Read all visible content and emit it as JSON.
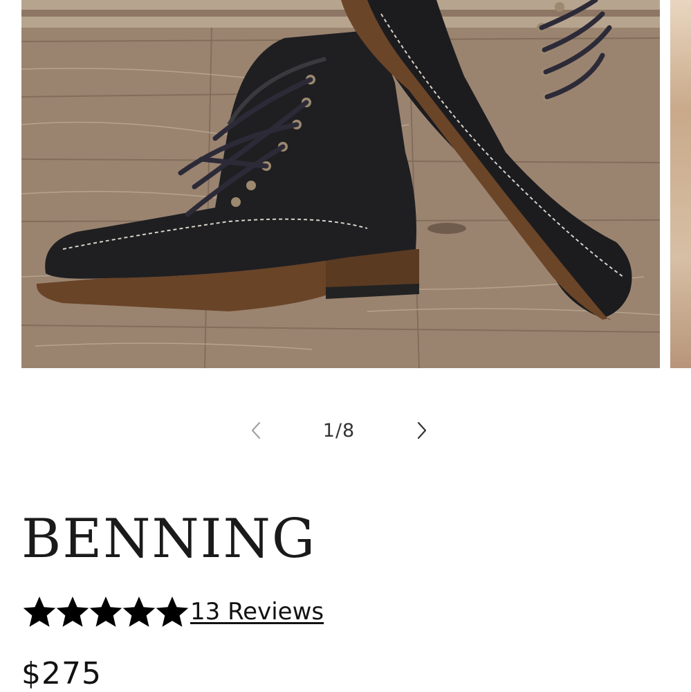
{
  "gallery": {
    "image_alt": "Benning boots",
    "slide_current": "1",
    "slide_total": "8",
    "counter_text": "1/8",
    "prev_label": "Previous slide",
    "next_label": "Next slide"
  },
  "product": {
    "title": "BENNING",
    "rating": 5,
    "rating_max": 5,
    "reviews_text": "13 Reviews",
    "price": "$275"
  },
  "colors": {
    "text": "#121212",
    "arrow": "#333333"
  },
  "icons": {
    "prev": "chevron-left-icon",
    "next": "chevron-right-icon",
    "star": "star-icon"
  }
}
